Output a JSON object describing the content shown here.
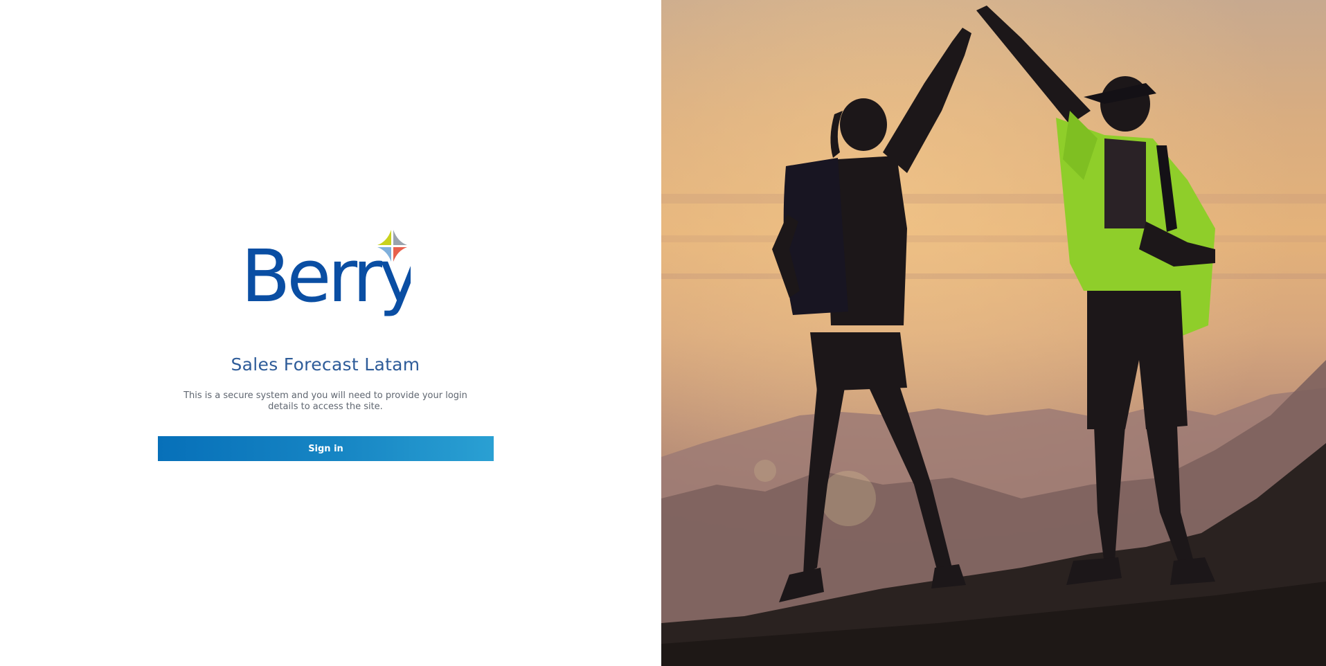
{
  "brand": {
    "logo_text": "Berry",
    "logo_color": "#0a4ea3",
    "star_colors": [
      "#c9d21e",
      "#9aa3ad",
      "#7fb0dc",
      "#e8604c"
    ]
  },
  "login": {
    "app_title": "Sales Forecast Latam",
    "description": "This is a secure system and you will need to provide your login details to access the site.",
    "sign_in_label": "Sign in"
  },
  "colors": {
    "title": "#2e5c99",
    "button_start": "#0770b9",
    "button_end": "#2aa0d3"
  },
  "hero_image": {
    "subject": "hikers-high-five-sunset"
  }
}
